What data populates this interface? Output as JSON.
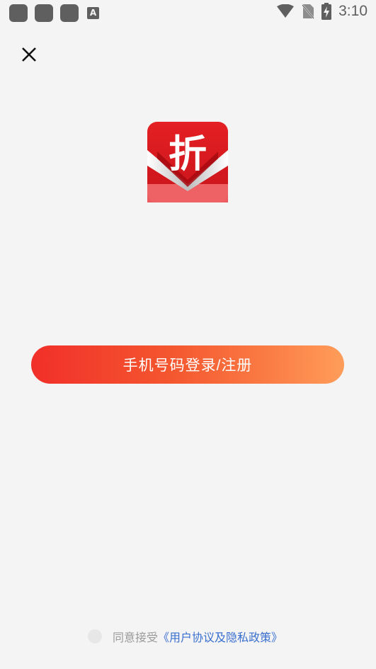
{
  "status_bar": {
    "time": "3:10",
    "keyboard_glyph": "A",
    "icons": [
      "app-icon",
      "app-icon",
      "app-icon",
      "keyboard-icon",
      "wifi-icon",
      "no-sim-icon",
      "battery-charging-icon"
    ]
  },
  "logo": {
    "glyph": "折",
    "colors": {
      "red": "#d7181e",
      "dark_red": "#a70b10",
      "silver": "#d9d9d9"
    }
  },
  "login": {
    "button_label": "手机号码登录/注册",
    "gradient_start": "#f12f2a",
    "gradient_end": "#ff9d5a"
  },
  "agreement": {
    "prefix": "同意接受",
    "link_label": "《用户协议及隐私政策》"
  }
}
